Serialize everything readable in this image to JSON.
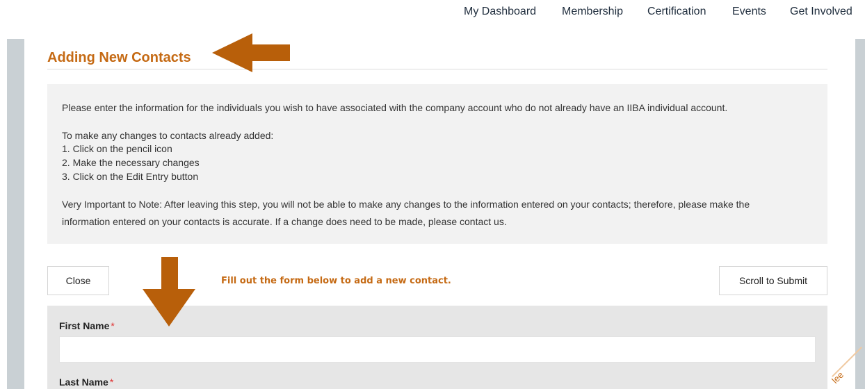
{
  "nav": {
    "items": [
      "My Dashboard",
      "Membership",
      "Certification",
      "Events",
      "Get Involved"
    ]
  },
  "page": {
    "title": "Adding New Contacts"
  },
  "info": {
    "intro": "Please enter the information for the individuals you wish to have associated with the company account who do not already have an IIBA individual account.",
    "changes_heading": "To make any changes to contacts already added:",
    "steps": [
      "1. Click on the pencil icon",
      "2. Make the necessary changes",
      "3. Click on the Edit Entry button"
    ],
    "note_line1": "Very Important to Note: After leaving this step, you will not be able to make any changes to the information entered on your contacts; therefore, please make the",
    "note_line2": "information entered on your contacts is accurate. If a change does need to be made, please contact us."
  },
  "actions": {
    "close_label": "Close",
    "fill_note": "Fill out the form below to add a new contact.",
    "scroll_label": "Scroll to Submit"
  },
  "form": {
    "first_name_label": "First Name",
    "last_name_label": "Last Name",
    "required_mark": "*"
  },
  "colors": {
    "accent": "#c56a14",
    "arrow": "#b85f0a",
    "required": "#e03131",
    "side_bar": "#c9d0d4"
  },
  "corner": {
    "text": "lee"
  }
}
